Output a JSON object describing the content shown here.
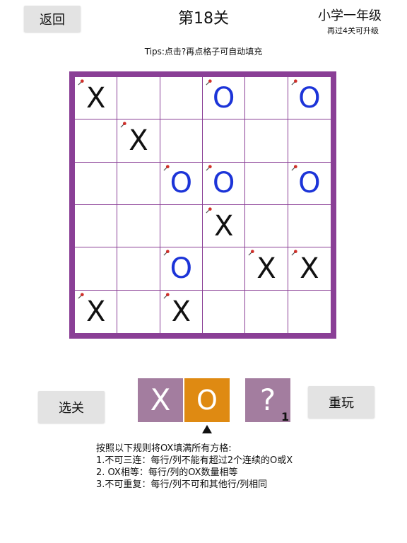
{
  "header": {
    "back_label": "返回",
    "title": "第18关",
    "grade": "小学一年级",
    "grade_sub": "再过4关可升级"
  },
  "tips": "Tips:点击?再点格子可自动填充",
  "board": {
    "rows": [
      [
        "X",
        "",
        "",
        "O",
        "",
        "O"
      ],
      [
        "",
        "X",
        "",
        "",
        "",
        ""
      ],
      [
        "",
        "",
        "O",
        "O",
        "",
        "O"
      ],
      [
        "",
        "",
        "",
        "X",
        "",
        ""
      ],
      [
        "",
        "",
        "O",
        "",
        "X",
        "X"
      ],
      [
        "X",
        "",
        "X",
        "",
        "",
        ""
      ]
    ],
    "pinned": [
      [
        true,
        false,
        false,
        true,
        false,
        true
      ],
      [
        false,
        true,
        false,
        false,
        false,
        false
      ],
      [
        false,
        false,
        true,
        true,
        false,
        true
      ],
      [
        false,
        false,
        false,
        true,
        false,
        false
      ],
      [
        false,
        false,
        true,
        false,
        true,
        true
      ],
      [
        true,
        false,
        true,
        false,
        false,
        false
      ]
    ]
  },
  "palette": {
    "x_label": "X",
    "o_label": "O",
    "q_label": "?",
    "hint_count": "1",
    "selected": "O"
  },
  "buttons": {
    "select_label": "选关",
    "replay_label": "重玩"
  },
  "rules": {
    "heading": "按照以下规则将OX填满所有方格:",
    "items": [
      "1.不可三连：每行/列不能有超过2个连续的O或X",
      "2.  OX相等：每行/列的OX数量相等",
      "3.不可重复：每行/列不可和其他行/列相同"
    ]
  },
  "colors": {
    "board_border": "#8a3f96",
    "x_color": "#111111",
    "o_color": "#1c34d8",
    "palette_default": "#a37d9f",
    "palette_selected": "#df8a12",
    "pin_color": "#d0302a"
  }
}
